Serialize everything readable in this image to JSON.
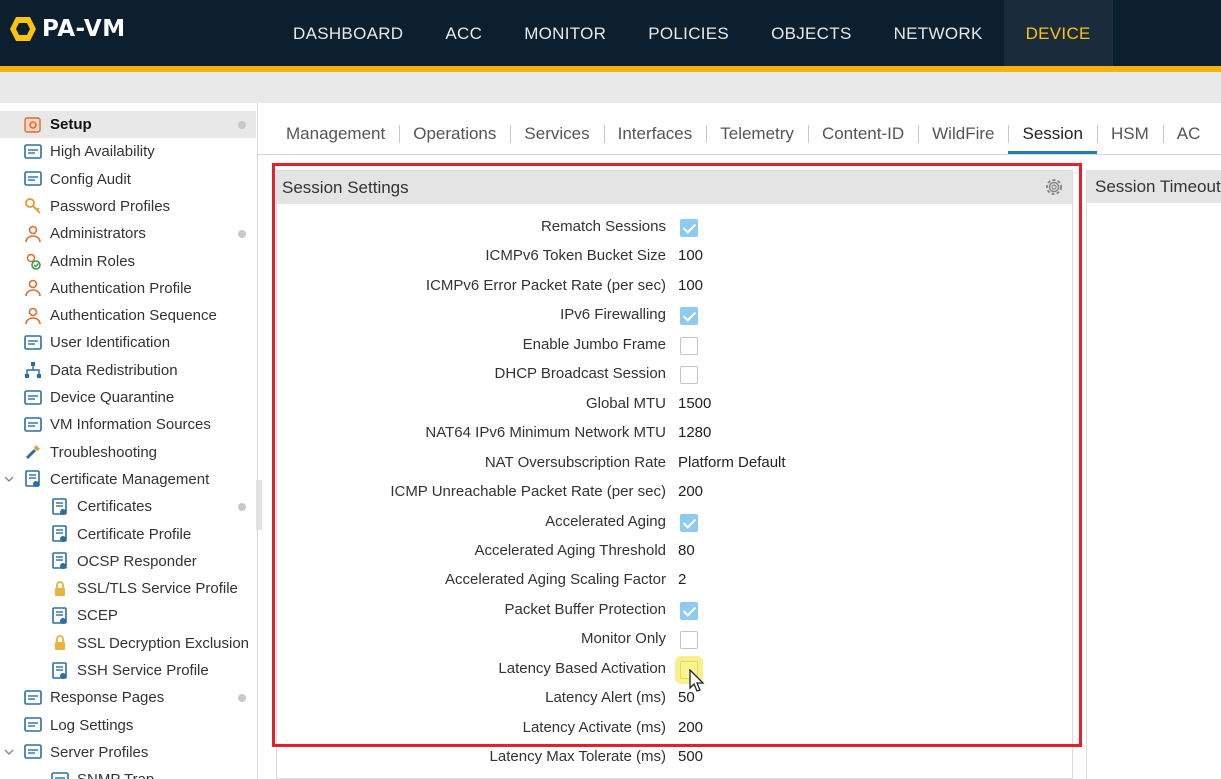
{
  "app": {
    "logo_text": "PA-VM"
  },
  "nav": {
    "items": [
      "DASHBOARD",
      "ACC",
      "MONITOR",
      "POLICIES",
      "OBJECTS",
      "NETWORK",
      "DEVICE"
    ],
    "active": "DEVICE"
  },
  "sidebar": {
    "items": [
      {
        "label": "Setup",
        "icon": "setup-icon",
        "selected": true,
        "dot": true
      },
      {
        "label": "High Availability",
        "icon": "high-availability-icon"
      },
      {
        "label": "Config Audit",
        "icon": "config-audit-icon"
      },
      {
        "label": "Password Profiles",
        "icon": "key-icon"
      },
      {
        "label": "Administrators",
        "icon": "user-icon",
        "dot": true
      },
      {
        "label": "Admin Roles",
        "icon": "admin-roles-icon"
      },
      {
        "label": "Authentication Profile",
        "icon": "auth-profile-icon"
      },
      {
        "label": "Authentication Sequence",
        "icon": "auth-sequence-icon"
      },
      {
        "label": "User Identification",
        "icon": "user-id-icon"
      },
      {
        "label": "Data Redistribution",
        "icon": "network-tree-icon"
      },
      {
        "label": "Device Quarantine",
        "icon": "quarantine-icon"
      },
      {
        "label": "VM Information Sources",
        "icon": "vm-icon"
      },
      {
        "label": "Troubleshooting",
        "icon": "wrench-icon"
      },
      {
        "label": "Certificate Management",
        "icon": "certificate-folder-icon",
        "expanded": true
      },
      {
        "label": "Certificates",
        "icon": "certificate-icon",
        "dot": true
      },
      {
        "label": "Certificate Profile",
        "icon": "certificate-icon"
      },
      {
        "label": "OCSP Responder",
        "icon": "certificate-icon"
      },
      {
        "label": "SSL/TLS Service Profile",
        "icon": "lock-icon"
      },
      {
        "label": "SCEP",
        "icon": "scep-icon"
      },
      {
        "label": "SSL Decryption Exclusion",
        "icon": "lock-icon"
      },
      {
        "label": "SSH Service Profile",
        "icon": "certificate-icon"
      },
      {
        "label": "Response Pages",
        "icon": "response-pages-icon",
        "dot": true
      },
      {
        "label": "Log Settings",
        "icon": "log-settings-icon"
      },
      {
        "label": "Server Profiles",
        "icon": "server-profiles-icon",
        "expanded": true
      },
      {
        "label": "SNMP Trap",
        "icon": "snmp-icon"
      }
    ]
  },
  "tabs": {
    "items": [
      "Management",
      "Operations",
      "Services",
      "Interfaces",
      "Telemetry",
      "Content-ID",
      "WildFire",
      "Session",
      "HSM",
      "AC"
    ],
    "active": "Session"
  },
  "session_settings": {
    "title": "Session Settings",
    "rows": [
      {
        "label": "Rematch Sessions",
        "type": "checkbox",
        "checked": true
      },
      {
        "label": "ICMPv6 Token Bucket Size",
        "type": "value",
        "value": "100"
      },
      {
        "label": "ICMPv6 Error Packet Rate (per sec)",
        "type": "value",
        "value": "100"
      },
      {
        "label": "IPv6 Firewalling",
        "type": "checkbox",
        "checked": true
      },
      {
        "label": "Enable Jumbo Frame",
        "type": "checkbox",
        "checked": false
      },
      {
        "label": "DHCP Broadcast Session",
        "type": "checkbox",
        "checked": false
      },
      {
        "label": "Global MTU",
        "type": "value",
        "value": "1500"
      },
      {
        "label": "NAT64 IPv6 Minimum Network MTU",
        "type": "value",
        "value": "1280"
      },
      {
        "label": "NAT Oversubscription Rate",
        "type": "value",
        "value": "Platform Default"
      },
      {
        "label": "ICMP Unreachable Packet Rate (per sec)",
        "type": "value",
        "value": "200"
      },
      {
        "label": "Accelerated Aging",
        "type": "checkbox",
        "checked": true
      },
      {
        "label": "Accelerated Aging Threshold",
        "type": "value",
        "value": "80"
      },
      {
        "label": "Accelerated Aging Scaling Factor",
        "type": "value",
        "value": "2"
      },
      {
        "label": "Packet Buffer Protection",
        "type": "checkbox",
        "checked": true
      },
      {
        "label": "Monitor Only",
        "type": "checkbox",
        "checked": false
      },
      {
        "label": "Latency Based Activation",
        "type": "checkbox",
        "checked": false,
        "highlighted": true
      },
      {
        "label": "Latency Alert (ms)",
        "type": "value",
        "value": "50"
      },
      {
        "label": "Latency Activate (ms)",
        "type": "value",
        "value": "200"
      },
      {
        "label": "Latency Max Tolerate (ms)",
        "type": "value",
        "value": "500"
      }
    ]
  },
  "session_timeouts": {
    "title": "Session Timeouts"
  },
  "colors": {
    "accent": "#f4b20e",
    "active_nav": "#ffc20e",
    "checkbox": "#8fcbf0",
    "highlight_box": "#e5202a"
  }
}
